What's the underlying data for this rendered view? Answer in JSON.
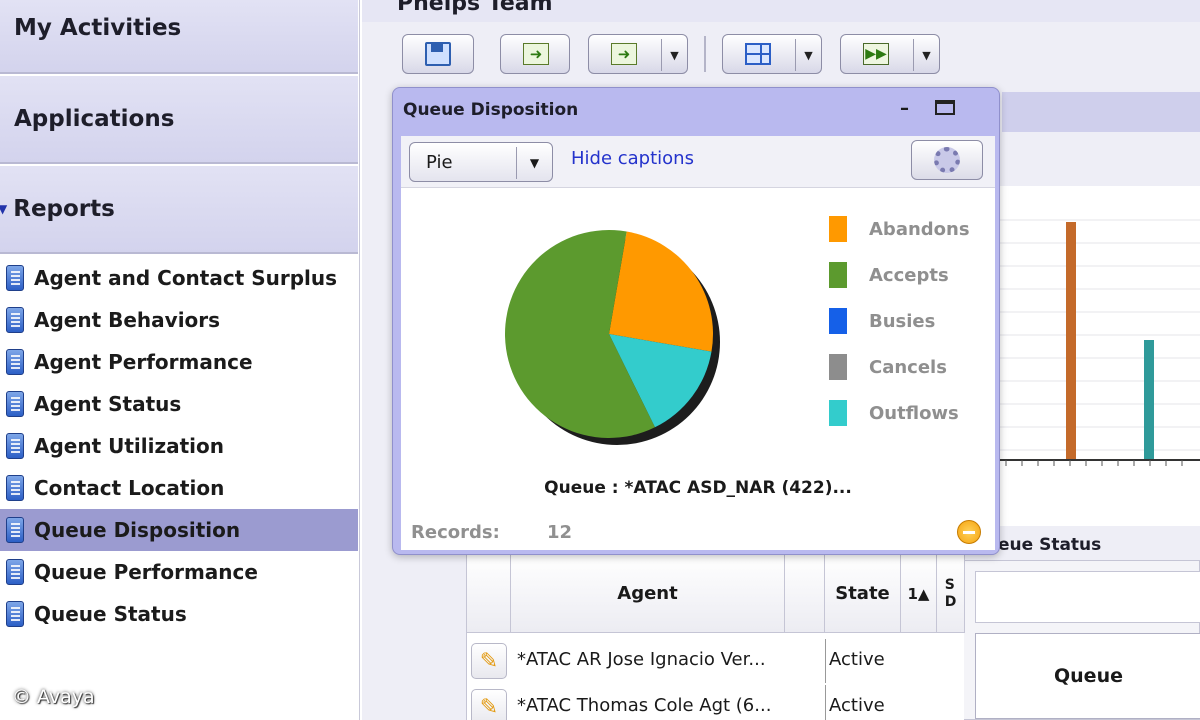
{
  "sidebar": {
    "sections": {
      "activities": "My Activities",
      "applications": "Applications",
      "reports": "Reports"
    },
    "reports": [
      "Agent and Contact Surplus",
      "Agent Behaviors",
      "Agent Performance",
      "Agent Status",
      "Agent Utilization",
      "Contact Location",
      "Queue Disposition",
      "Queue Performance",
      "Queue Status"
    ],
    "selected_report": "Queue Disposition"
  },
  "main": {
    "team_title": "Phelps Team"
  },
  "popup": {
    "title": "Queue Disposition",
    "chart_type_select": "Pie",
    "hide_captions_link": "Hide captions",
    "queue_caption": "Queue : *ATAC ASD_NAR (422)...",
    "records_label": "Records:",
    "records_value": "12"
  },
  "chart_data": {
    "type": "pie",
    "labels": [
      "Abandons",
      "Accepts",
      "Busies",
      "Cancels",
      "Outflows"
    ],
    "values": [
      0.25,
      0.6,
      0,
      0,
      0.15
    ],
    "colors": [
      "#ff9900",
      "#5c9a2e",
      "#1560e8",
      "#8d8d8d",
      "#33cccc"
    ]
  },
  "right_panel": {
    "queue_status_title": "eue Status",
    "queue_button": "Queue"
  },
  "agent_table": {
    "headers": {
      "agent": "Agent",
      "state": "State",
      "sort": "1▲",
      "more": "S\nD"
    },
    "rows": [
      {
        "agent": "*ATAC AR Jose Ignacio Ver...",
        "state": "Active"
      },
      {
        "agent": "*ATAC Thomas Cole Agt (6...",
        "state": "Active"
      }
    ]
  },
  "copyright": "© Avaya"
}
